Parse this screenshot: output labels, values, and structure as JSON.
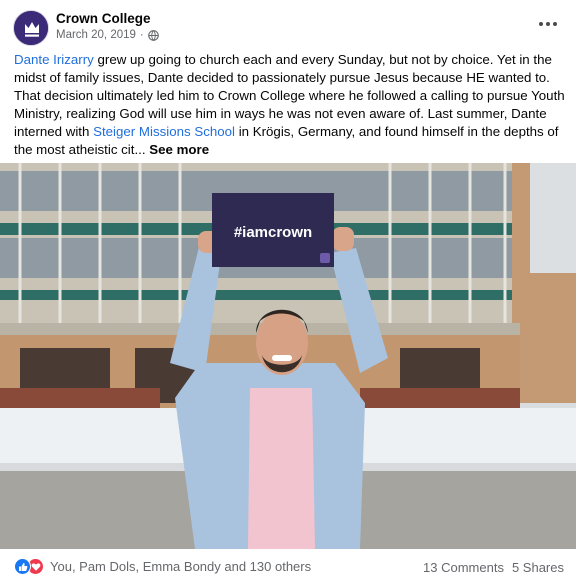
{
  "post": {
    "page_name": "Crown College",
    "date": "March 20, 2019",
    "date_separator": "·",
    "privacy_icon": "globe-icon",
    "more_icon": "more-options-icon",
    "avatar_icon": "crown-logo-icon",
    "text": {
      "mention_1": "Dante Irizarry",
      "part_1": " grew up going to church each and every Sunday, but not by choice. Yet in the midst of family issues, Dante decided to passionately pursue Jesus because HE wanted to. That decision ultimately led him to Crown College where he followed a calling to pursue Youth Ministry, realizing God will use him in ways he was not even aware of. Last summer, Dante interned with ",
      "mention_2": "Steiger Missions School",
      "part_2": " in Krögis, Germany, and found himself in the depths of the most atheistic cit... ",
      "see_more": "See more"
    },
    "photo": {
      "sign_text": "#iamcrown"
    },
    "footer": {
      "reaction_icons": [
        "like-icon",
        "love-icon"
      ],
      "reactors": "You, Pam Dols, Emma Bondy and 130 others",
      "comments": "13 Comments",
      "shares": "5 Shares"
    },
    "colors": {
      "link": "#216fdb",
      "brand_purple": "#3b2a78",
      "like_blue": "#1877f2",
      "love_red": "#f0384f"
    }
  }
}
